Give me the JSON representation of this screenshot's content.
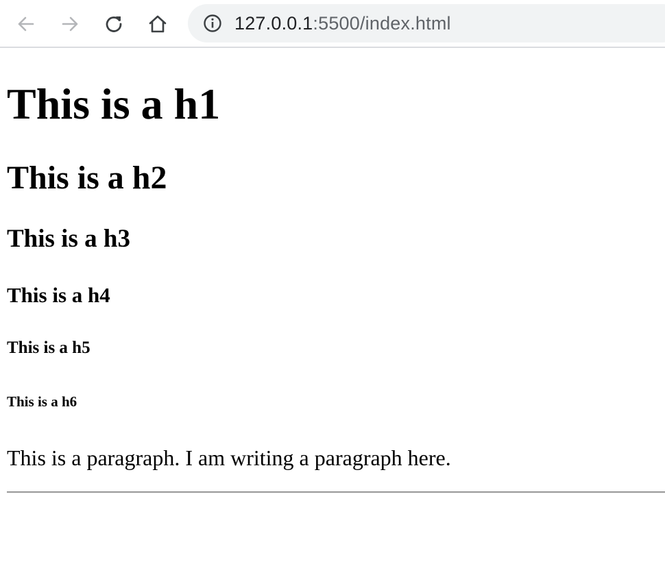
{
  "browser": {
    "url_host": "127.0.0.1",
    "url_rest": ":5500/index.html",
    "icons": {
      "back": "arrow-left-icon",
      "forward": "arrow-right-icon",
      "reload": "reload-icon",
      "home": "home-icon",
      "info": "info-icon"
    }
  },
  "page": {
    "h1": "This is a h1",
    "h2": "This is a h2",
    "h3": "This is a h3",
    "h4": "This is a h4",
    "h5": "This is a h5",
    "h6": "This is a h6",
    "paragraph": "This is a paragraph. I am writing a paragraph here."
  }
}
